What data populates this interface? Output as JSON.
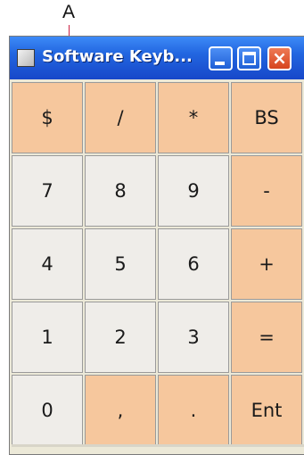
{
  "callout": {
    "label": "A"
  },
  "window": {
    "title": "Software Keyb...",
    "close_glyph": "×",
    "colors": {
      "title_bar": "#2266e0",
      "close_button": "#d6441e"
    }
  },
  "keypad": {
    "colors": {
      "operator_key": "#f6c79d",
      "digit_key": "#efede9"
    },
    "rows": [
      [
        {
          "label": "$",
          "style": "peach",
          "name": "dollar-key"
        },
        {
          "label": "/",
          "style": "peach",
          "name": "slash-key"
        },
        {
          "label": "*",
          "style": "peach",
          "name": "asterisk-key"
        },
        {
          "label": "BS",
          "style": "peach",
          "name": "backspace-key"
        }
      ],
      [
        {
          "label": "7",
          "style": "light",
          "name": "digit-7-key"
        },
        {
          "label": "8",
          "style": "light",
          "name": "digit-8-key"
        },
        {
          "label": "9",
          "style": "light",
          "name": "digit-9-key"
        },
        {
          "label": "-",
          "style": "peach",
          "name": "minus-key"
        }
      ],
      [
        {
          "label": "4",
          "style": "light",
          "name": "digit-4-key"
        },
        {
          "label": "5",
          "style": "light",
          "name": "digit-5-key"
        },
        {
          "label": "6",
          "style": "light",
          "name": "digit-6-key"
        },
        {
          "label": "+",
          "style": "peach",
          "name": "plus-key"
        }
      ],
      [
        {
          "label": "1",
          "style": "light",
          "name": "digit-1-key"
        },
        {
          "label": "2",
          "style": "light",
          "name": "digit-2-key"
        },
        {
          "label": "3",
          "style": "light",
          "name": "digit-3-key"
        },
        {
          "label": "=",
          "style": "peach",
          "name": "equals-key"
        }
      ],
      [
        {
          "label": "0",
          "style": "light",
          "name": "digit-0-key"
        },
        {
          "label": ",",
          "style": "peach",
          "name": "comma-key"
        },
        {
          "label": ".",
          "style": "peach",
          "name": "period-key"
        },
        {
          "label": "Ent",
          "style": "peach",
          "name": "enter-key"
        }
      ]
    ]
  }
}
